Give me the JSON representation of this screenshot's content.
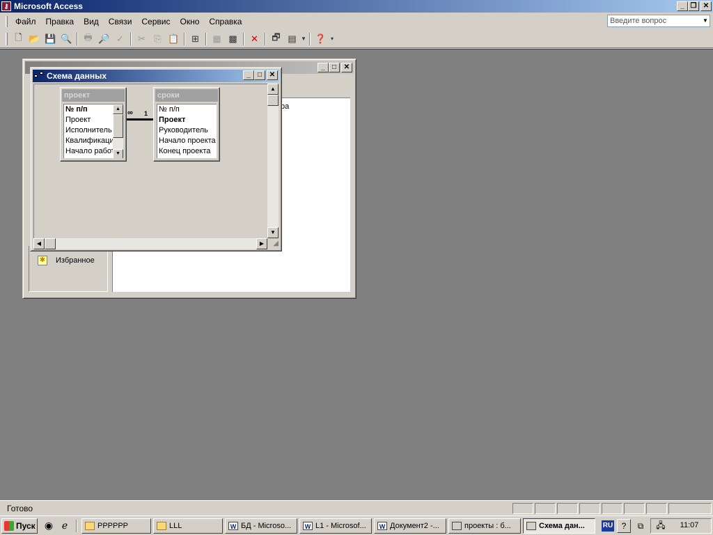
{
  "app": {
    "title": "Microsoft Access"
  },
  "menu": [
    "Файл",
    "Правка",
    "Вид",
    "Связи",
    "Сервис",
    "Окно",
    "Справка"
  ],
  "help_box": {
    "placeholder": "Введите вопрос"
  },
  "db_window": {
    "favorites_label": "Избранное",
    "pane_text": "ра"
  },
  "schema_window": {
    "title": "Схема данных",
    "tables": [
      {
        "name": "проект",
        "fields": [
          {
            "label": "№ п/п",
            "key": true
          },
          {
            "label": "Проект",
            "key": false
          },
          {
            "label": "Исполнитель",
            "key": false
          },
          {
            "label": "Квалификация",
            "key": false
          },
          {
            "label": "Начало работы",
            "key": false
          }
        ]
      },
      {
        "name": "сроки",
        "fields": [
          {
            "label": "№ п/п",
            "key": false
          },
          {
            "label": "Проект",
            "key": true
          },
          {
            "label": "Руководитель",
            "key": false
          },
          {
            "label": "Начало проекта",
            "key": false
          },
          {
            "label": "Конец проекта",
            "key": false
          }
        ]
      }
    ],
    "relationship": {
      "many_symbol": "∞",
      "one_symbol": "1"
    }
  },
  "status": {
    "text": "Готово"
  },
  "taskbar": {
    "start_label": "Пуск",
    "tasks": [
      {
        "label": "PPPPPP",
        "kind": "folder",
        "icon_text": ""
      },
      {
        "label": "LLL",
        "kind": "folder",
        "icon_text": ""
      },
      {
        "label": "БД - Microso...",
        "kind": "word",
        "icon_text": "W"
      },
      {
        "label": "L1 - Microsof...",
        "kind": "word",
        "icon_text": "W"
      },
      {
        "label": "Документ2 -...",
        "kind": "word",
        "icon_text": "W"
      },
      {
        "label": "проекты : б...",
        "kind": "db",
        "icon_text": ""
      },
      {
        "label": "Схема дан...",
        "kind": "schema",
        "icon_text": "",
        "active": true
      }
    ],
    "language": "RU",
    "clock": "11:07"
  }
}
